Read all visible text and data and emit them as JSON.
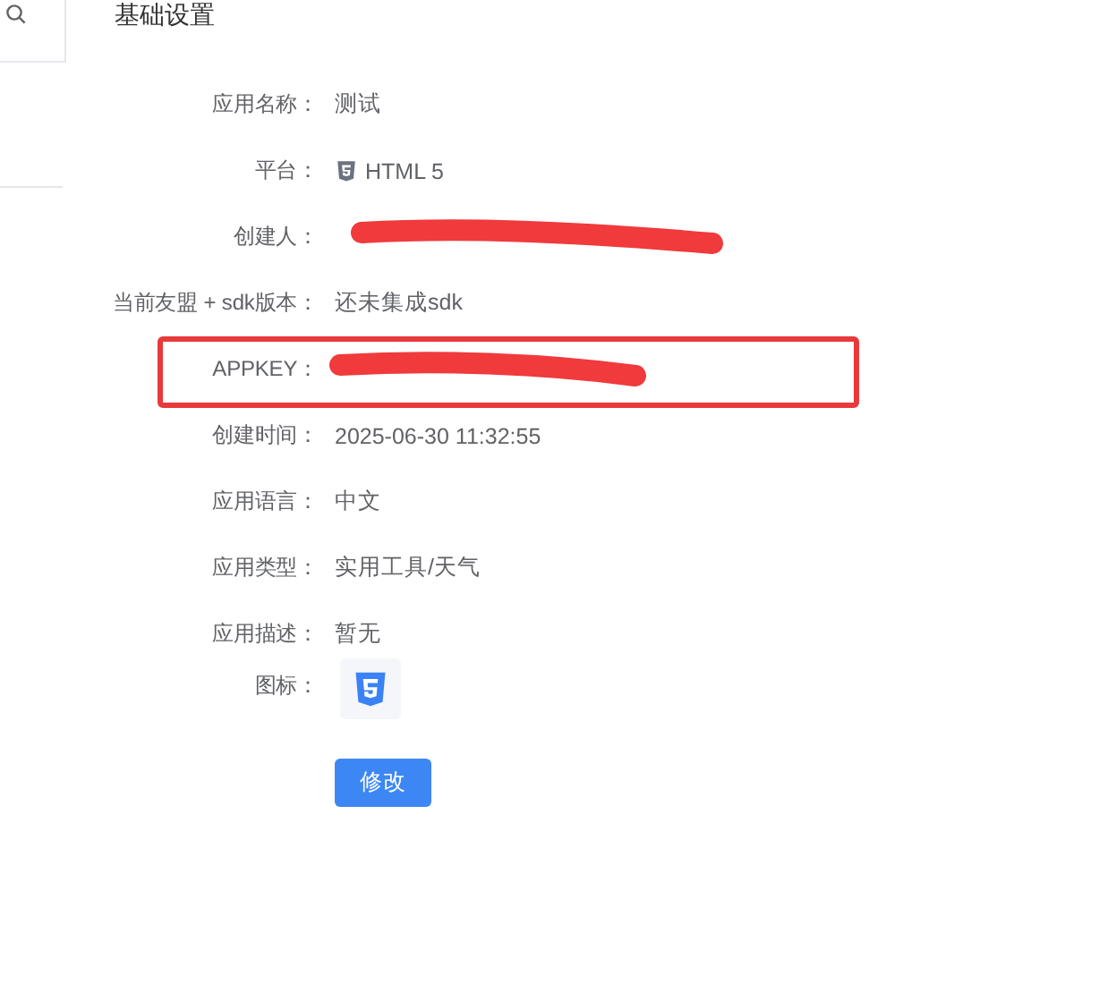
{
  "section": {
    "title": "基础设置"
  },
  "fields": [
    {
      "kind": "text",
      "label": "应用名称：",
      "value": "测试",
      "highlighted": false
    },
    {
      "kind": "platform",
      "label": "平台：",
      "value": "HTML 5",
      "highlighted": false
    },
    {
      "kind": "redacted",
      "label": "创建人：",
      "highlighted": false
    },
    {
      "kind": "text",
      "label": "当前友盟 + sdk版本：",
      "value": "还未集成sdk",
      "highlighted": false
    },
    {
      "kind": "redacted",
      "label": "APPKEY：",
      "highlighted": true
    },
    {
      "kind": "text",
      "label": "创建时间：",
      "value": "2025-06-30 11:32:55",
      "highlighted": false
    },
    {
      "kind": "text",
      "label": "应用语言：",
      "value": "中文",
      "highlighted": false
    },
    {
      "kind": "text",
      "label": "应用类型：",
      "value": "实用工具/天气",
      "highlighted": false
    },
    {
      "kind": "text",
      "label": "应用描述：",
      "value": "暂无",
      "highlighted": false
    },
    {
      "kind": "icon",
      "label": "图标：",
      "highlighted": false
    }
  ],
  "edit_button": {
    "label": "修改"
  }
}
